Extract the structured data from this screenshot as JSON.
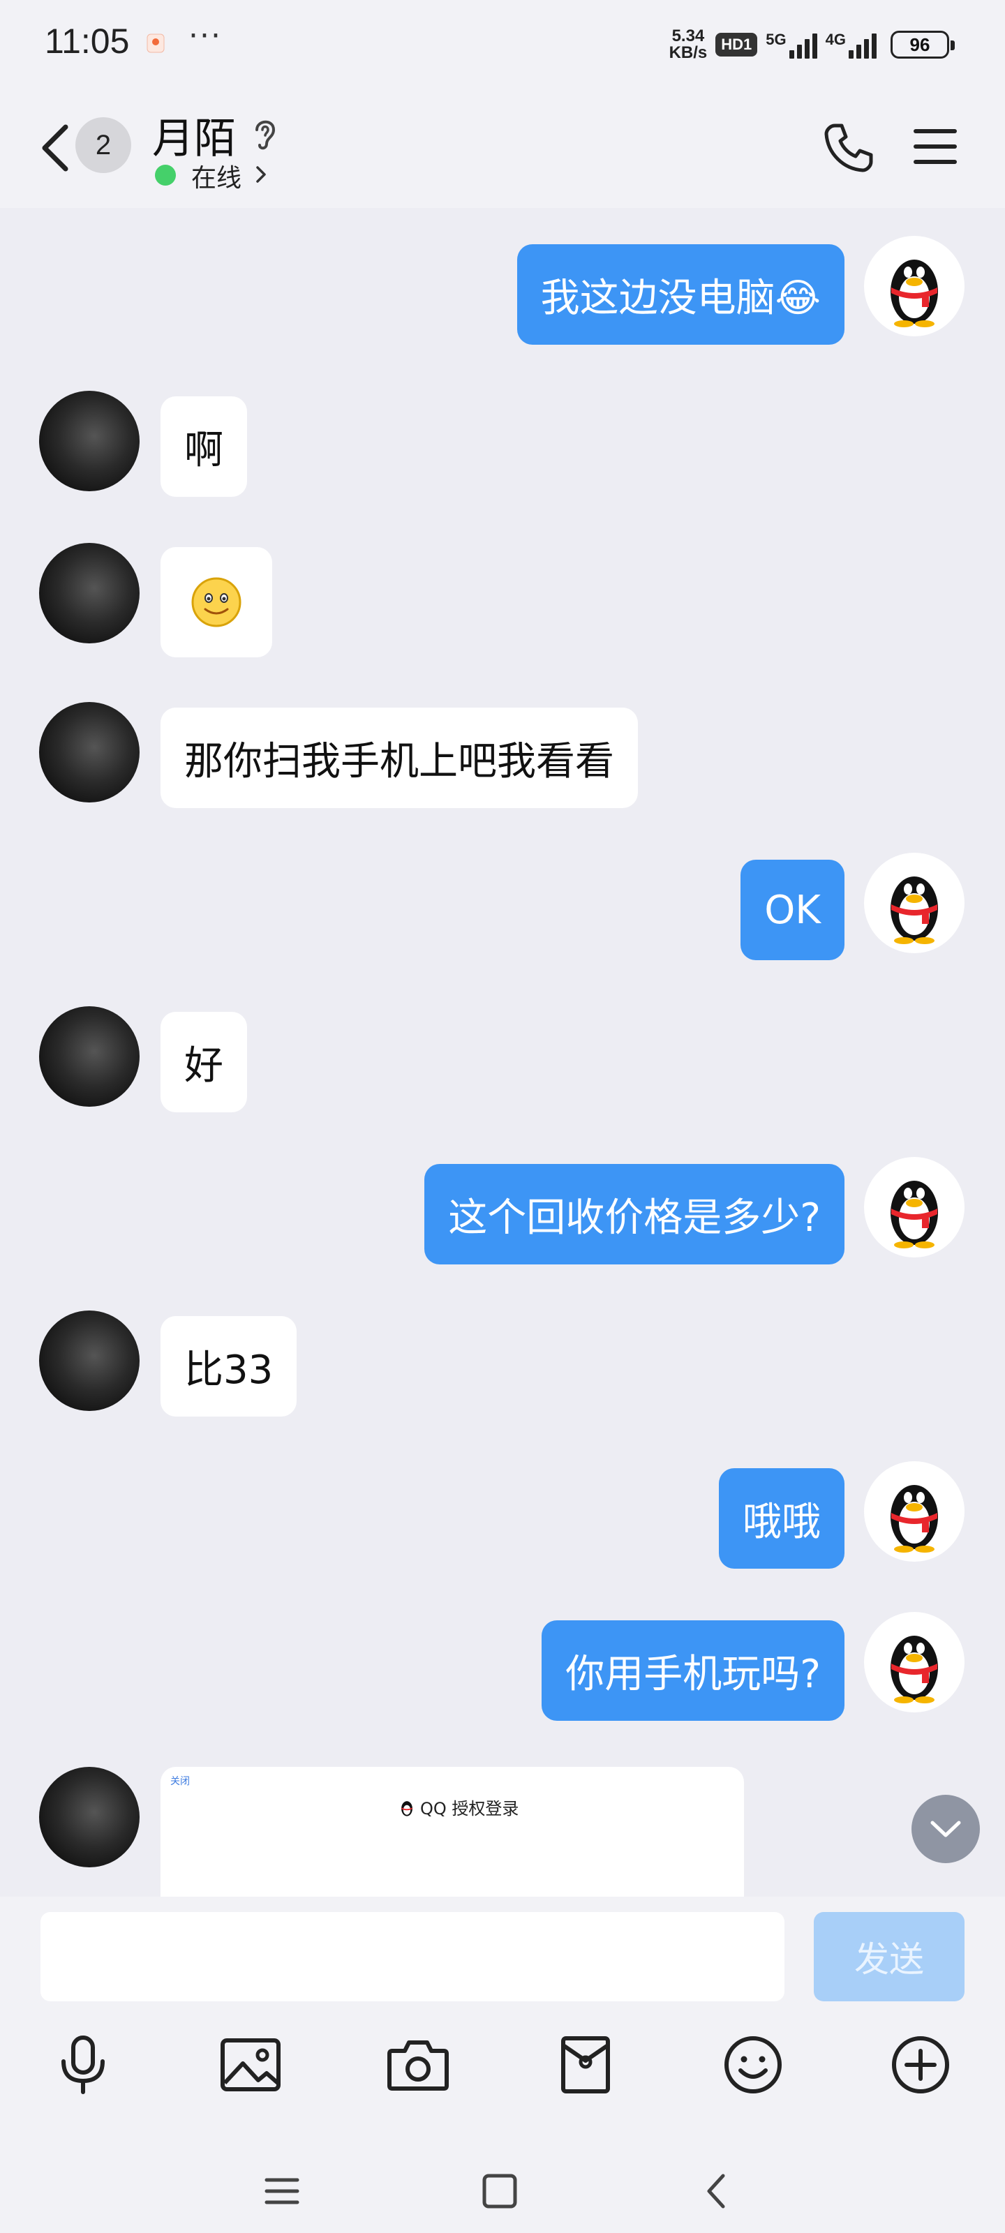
{
  "status_bar": {
    "time": "11:05",
    "more": "···",
    "net_speed_value": "5.34",
    "net_speed_unit": "KB/s",
    "hd_label": "HD1",
    "sim1_label": "5G",
    "sim2_label": "4G",
    "battery": "96"
  },
  "header": {
    "unread_count": "2",
    "contact_name": "月陌",
    "online_status": "在线"
  },
  "messages": [
    {
      "from": "me",
      "text": "我这边没电脑😂"
    },
    {
      "from": "peer",
      "text": "啊"
    },
    {
      "from": "peer",
      "text": "🙂"
    },
    {
      "from": "peer",
      "text": "那你扫我手机上吧我看看"
    },
    {
      "from": "me",
      "text": "OK"
    },
    {
      "from": "peer",
      "text": "好"
    },
    {
      "from": "me",
      "text": "这个回收价格是多少?"
    },
    {
      "from": "peer",
      "text": "比33"
    },
    {
      "from": "me",
      "text": "哦哦"
    },
    {
      "from": "me",
      "text": "你用手机玩吗?"
    }
  ],
  "shared_card": {
    "close_label": "关闭",
    "title": "QQ 授权登录"
  },
  "composer": {
    "input_value": "",
    "send_label": "发送"
  },
  "toolbar_icons": [
    "microphone-icon",
    "image-icon",
    "camera-icon",
    "red-packet-icon",
    "emoji-icon",
    "plus-icon"
  ],
  "colors": {
    "my_bubble": "#3d95f5",
    "peer_bubble": "#ffffff",
    "background": "#ededf3",
    "online": "#45d06a",
    "send_disabled": "#a8cff8"
  }
}
